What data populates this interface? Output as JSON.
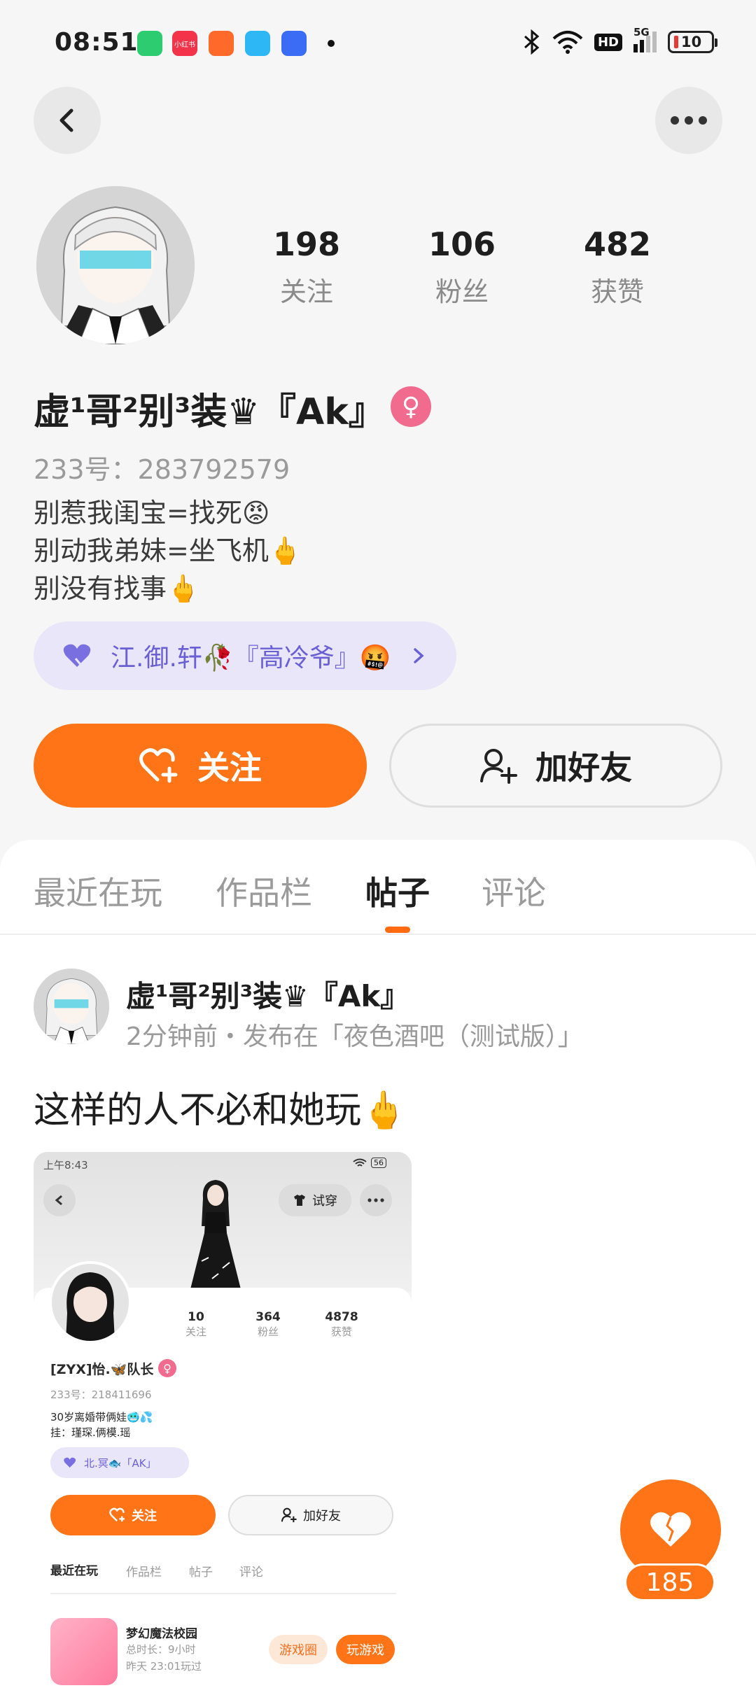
{
  "status_bar": {
    "time": "08:51",
    "apps": [
      {
        "icon": "battery-saver-app-icon",
        "color": "#2ecc71"
      },
      {
        "icon": "xiaohongshu-app-icon",
        "color": "#f2334a",
        "label": "小红书"
      },
      {
        "icon": "grid-app-icon",
        "color": "#ff6a2a"
      },
      {
        "icon": "video-app-icon",
        "color": "#2db7f5"
      },
      {
        "icon": "baidu-app-icon",
        "color": "#3a6cf5"
      }
    ],
    "hd": "HD",
    "network": "5G",
    "battery": "10"
  },
  "profile": {
    "stats": [
      {
        "value": "198",
        "label": "关注"
      },
      {
        "value": "106",
        "label": "粉丝"
      },
      {
        "value": "482",
        "label": "获赞"
      }
    ],
    "nickname": "虚¹哥²别³装♛『Ak』",
    "gender_symbol": "♀",
    "uid": "233号：283792579",
    "bio": [
      "别惹我闺宝=找死😡",
      "别动我弟妹=坐飞机🖕",
      "别没有找事🖕"
    ],
    "cp_text": "江.御.轩🥀『高冷爷』🤬",
    "follow_label": "关注",
    "add_friend_label": "加好友"
  },
  "tabs": [
    "最近在玩",
    "作品栏",
    "帖子",
    "评论"
  ],
  "active_tab": "帖子",
  "post": {
    "author": "虚¹哥²别³装♛『Ak』",
    "meta": "2分钟前・发布在「夜色酒吧（测试版）」",
    "text": "这样的人不必和她玩🖕",
    "screenshot": {
      "time": "上午8:43",
      "battery": "56",
      "try_on": "试穿",
      "stats": [
        {
          "value": "10",
          "label": "关注"
        },
        {
          "value": "364",
          "label": "粉丝"
        },
        {
          "value": "4878",
          "label": "获赞"
        }
      ],
      "nickname": "[ZYX]怡.🦋队长",
      "uid": "233号：218411696",
      "bio": [
        "30岁离婚带俩娃🥶💦",
        "挂：瑾琛.俩模.瑶"
      ],
      "cp": "北.冥🐟「AK」",
      "follow": "关注",
      "add_friend": "加好友",
      "tabs": [
        "最近在玩",
        "作品栏",
        "帖子",
        "评论"
      ],
      "game": {
        "name": "梦幻魔法校园",
        "duration": "总时长：9小时",
        "last_played": "昨天 23:01玩过",
        "circle": "游戏圈",
        "play": "玩游戏"
      }
    }
  },
  "like_count": "185",
  "colors": {
    "accent": "#ff7417",
    "cp_purple": "#6a5fd4",
    "gender_pink": "#f06b8e"
  }
}
